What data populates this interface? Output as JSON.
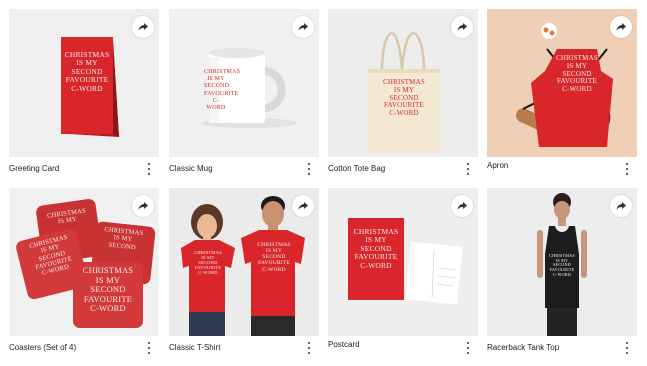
{
  "design_text": [
    "CHRISTMAS",
    "IS MY",
    "SECOND",
    "FAVOURITE",
    "C-WORD"
  ],
  "colors": {
    "accent_red": "#d8262a",
    "text": "#222222",
    "bg": "#ffffff"
  },
  "icons": {
    "share": "share-arrow-icon",
    "more": "more-vertical-icon"
  },
  "products": [
    {
      "title": "Greeting Card"
    },
    {
      "title": "Classic Mug"
    },
    {
      "title": "Cotton Tote Bag"
    },
    {
      "title": "Apron"
    },
    {
      "title": "Coasters (Set of 4)"
    },
    {
      "title": "Classic T-Shirt"
    },
    {
      "title": "Postcard"
    },
    {
      "title": "Racerback Tank Top"
    }
  ]
}
